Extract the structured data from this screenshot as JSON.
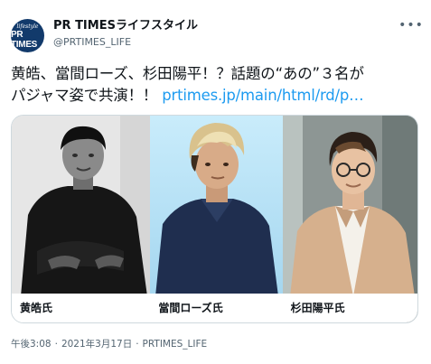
{
  "account": {
    "avatar_small_text": "lifestyle",
    "avatar_big_text": "PR TIMES",
    "display_name": "PR TIMESライフスタイル",
    "handle": "@PRTIMES_LIFE",
    "more_icon": "more-dots-icon"
  },
  "tweet": {
    "line1": "黄皓、當間ローズ、杉田陽平！？話題の“あの”３名が",
    "line2_text": "パジャマ姿で共演！！ ",
    "link_text": "prtimes.jp/main/html/rd/p…"
  },
  "media": {
    "captions": [
      "黄皓氏",
      "當間ローズ氏",
      "杉田陽平氏"
    ]
  },
  "meta": {
    "time": "午後3:08",
    "separator": "·",
    "date": "2021年3月17日",
    "source": "PRTIMES_LIFE"
  },
  "colors": {
    "link": "#1d9bf0",
    "secondary_text": "#536471",
    "avatar_bg": "#123a6b",
    "border": "#cfd9de"
  }
}
